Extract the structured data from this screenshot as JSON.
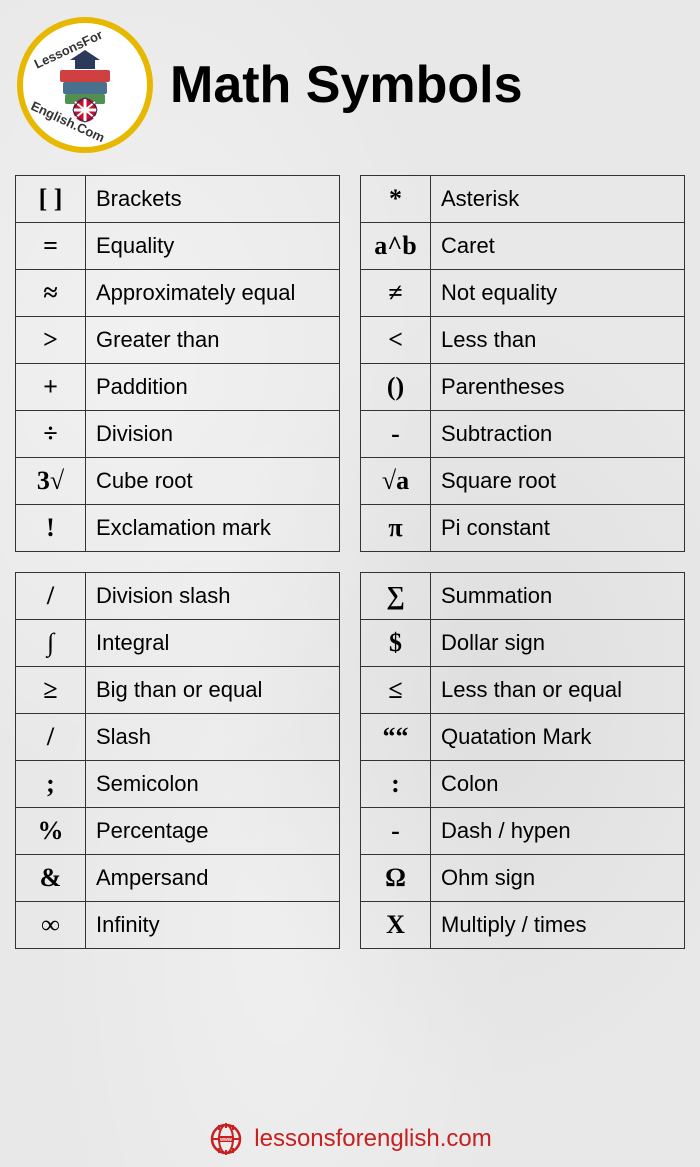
{
  "title": "Math Symbols",
  "logo": {
    "text_top": "LessonsFor",
    "text_bottom": "English.Com"
  },
  "tables": [
    [
      {
        "symbol": "[ ]",
        "name": "Brackets"
      },
      {
        "symbol": "=",
        "name": "Equality"
      },
      {
        "symbol": "≈",
        "name": "Approximately equal"
      },
      {
        "symbol": ">",
        "name": "Greater than"
      },
      {
        "symbol": "+",
        "name": "Paddition"
      },
      {
        "symbol": "÷",
        "name": "Division"
      },
      {
        "symbol": "3√",
        "name": "Cube root"
      },
      {
        "symbol": "!",
        "name": "Exclamation mark"
      }
    ],
    [
      {
        "symbol": "*",
        "name": "Asterisk"
      },
      {
        "symbol": "a^b",
        "name": "Caret"
      },
      {
        "symbol": "≠",
        "name": "Not equality"
      },
      {
        "symbol": "<",
        "name": "Less than"
      },
      {
        "symbol": "()",
        "name": "Parentheses"
      },
      {
        "symbol": "-",
        "name": "Subtraction"
      },
      {
        "symbol": "√a",
        "name": "Square root"
      },
      {
        "symbol": "π",
        "name": "Pi constant"
      }
    ],
    [
      {
        "symbol": "/",
        "name": "Division slash"
      },
      {
        "symbol": "∫",
        "name": "Integral"
      },
      {
        "symbol": "≥",
        "name": "Big than or equal"
      },
      {
        "symbol": "/",
        "name": "Slash"
      },
      {
        "symbol": ";",
        "name": "Semicolon"
      },
      {
        "symbol": "%",
        "name": "Percentage"
      },
      {
        "symbol": "&",
        "name": "Ampersand"
      },
      {
        "symbol": "∞",
        "name": "Infinity"
      }
    ],
    [
      {
        "symbol": "∑",
        "name": "Summation"
      },
      {
        "symbol": "$",
        "name": "Dollar sign"
      },
      {
        "symbol": "≤",
        "name": "Less than or equal"
      },
      {
        "symbol": "““",
        "name": "Quatation Mark"
      },
      {
        "symbol": ":",
        "name": "Colon"
      },
      {
        "symbol": "-",
        "name": "Dash / hypen"
      },
      {
        "symbol": "Ω",
        "name": "Ohm sign"
      },
      {
        "symbol": "X",
        "name": "Multiply / times"
      }
    ]
  ],
  "footer": {
    "text": "lessonsforenglish.com"
  }
}
